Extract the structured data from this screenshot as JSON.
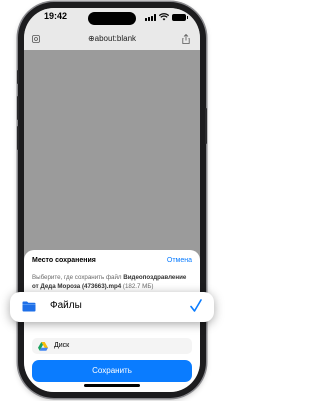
{
  "status_bar": {
    "time": "19:42"
  },
  "browser": {
    "url": "about:blank"
  },
  "sheet": {
    "title": "Место сохранения",
    "cancel_label": "Отмена",
    "description_prefix": "Выберите, где сохранить файл ",
    "filename": "Видеопоздравление от Деда Мороза (473663).mp4",
    "filesize": "(182.7 МБ)",
    "options": [
      {
        "label": "Файлы",
        "icon": "folder-icon",
        "selected": true
      },
      {
        "label": "Диск",
        "icon": "google-drive-icon",
        "selected": false
      }
    ],
    "save_label": "Сохранить"
  },
  "colors": {
    "accent": "#0a7cff",
    "dimmed_background": "#9b9b9b",
    "folder": "#1e6fe8"
  }
}
